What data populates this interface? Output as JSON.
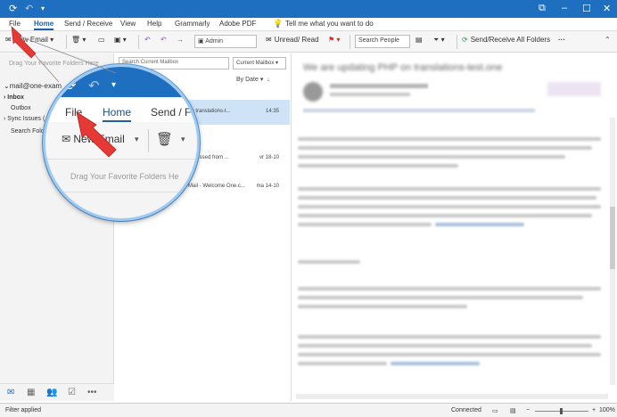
{
  "titlebar": {
    "accent": "#1f6fc0",
    "sync_icon": "sync-icon",
    "undo_icon": "undo-icon",
    "qa_icon": "customize-quick-access-icon",
    "window_buttons": [
      "⧉",
      "–",
      "☐",
      "✕"
    ]
  },
  "menubar": {
    "tabs": [
      "File",
      "Home",
      "Send / Receive",
      "View",
      "Help",
      "Grammarly",
      "Adobe PDF"
    ],
    "active_tab": "Home",
    "tell_me": "Tell me what you want to do"
  },
  "ribbon": {
    "new_email": "New Email",
    "category": "Admin",
    "unread_read": "Unread/ Read",
    "search_people_placeholder": "Search People",
    "send_receive_all": "Send/Receive All Folders",
    "more": "···"
  },
  "leftnav": {
    "drag_hint": "Drag Your Favorite Folders Here",
    "account": "mail@one-exam",
    "folders": [
      "Inbox",
      "Outbox",
      "Sync Issues (",
      "Search Fold"
    ],
    "bottom_icons": [
      "mail-icon",
      "calendar-icon",
      "people-icon",
      "tasks-icon",
      "more-icon"
    ]
  },
  "maillist": {
    "search_placeholder": "Search Current Mailbox",
    "scope": "Current Mailbox",
    "sort_by": "By Date",
    "rows": [
      {
        "subject": "on translations-t...",
        "date": "14:35",
        "selected": true
      },
      {
        "subject": "accessed from ...",
        "date": "vr 18-10",
        "selected": false
      },
      {
        "subject": "Mail - Welcome One.c...",
        "date": "ma 14-10",
        "selected": false
      }
    ]
  },
  "reading": {
    "subject": "We are updating PHP on translations-test.one"
  },
  "statusbar": {
    "filter": "Filter applied",
    "connected": "Connected",
    "zoom": "100%"
  },
  "magnifier": {
    "tabs": [
      "File",
      "Home",
      "Send / F"
    ],
    "active_tab": "Home",
    "new_email": "New Email",
    "drag_hint": "Drag Your Favorite Folders He",
    "pointer_color": "#e53935"
  }
}
